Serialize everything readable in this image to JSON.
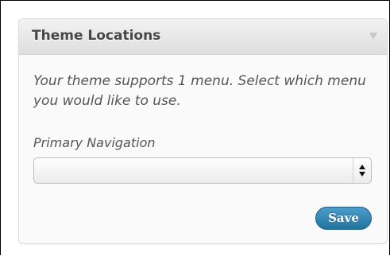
{
  "panel": {
    "title": "Theme Locations",
    "description": "Your theme supports 1 menu. Select which menu you would like to use.",
    "toggle_icon": "collapse-arrow-icon"
  },
  "menu_location": {
    "label": "Primary Navigation",
    "selected_value": "",
    "select_icon": "updown-chevron-icon"
  },
  "actions": {
    "save_label": "Save"
  },
  "colors": {
    "accent": "#21759b",
    "header_bg": "#dfdfdf",
    "text": "#555555"
  }
}
